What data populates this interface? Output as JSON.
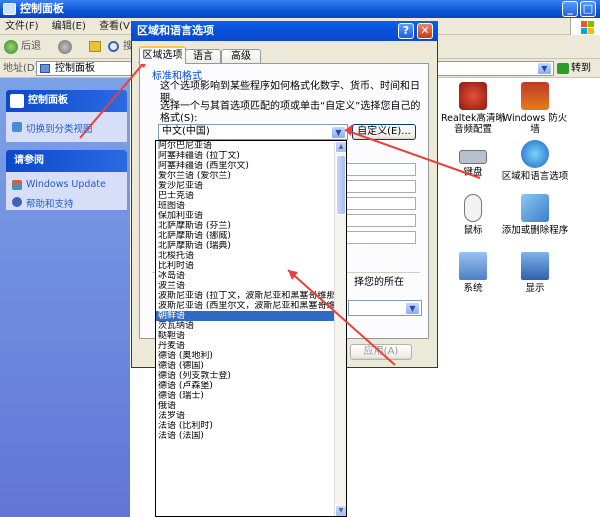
{
  "window": {
    "title": "控制面板"
  },
  "menu": [
    "文件(F)",
    "编辑(E)",
    "查看(V)"
  ],
  "toolbar": {
    "back": "后退",
    "search": "搜"
  },
  "address": {
    "label": "地址(D)",
    "value": "控制面板",
    "go": "转到"
  },
  "sidebar": {
    "panel_title": "控制面板",
    "switch_link": "切换到分类视图",
    "see_also_title": "请参阅",
    "see_also": [
      "Windows Update",
      "帮助和支持"
    ]
  },
  "icons": [
    {
      "label": "Realtek高清晰音频配置"
    },
    {
      "label": "Windows 防火墙"
    },
    {
      "label": "键盘"
    },
    {
      "label": "区域和语言选项"
    },
    {
      "label": "鼠标"
    },
    {
      "label": "添加或删除程序"
    },
    {
      "label": "系统"
    },
    {
      "label": "显示"
    }
  ],
  "dialog": {
    "title": "区域和语言选项",
    "help_btn": "?",
    "close_btn": "✕",
    "tabs": [
      "区域选项",
      "语言",
      "高级"
    ],
    "group_title": "标准和格式",
    "desc": "这个选项影响到某些程序如何格式化数字、货币、时间和日期。",
    "prompt": "选择一个与其首选项匹配的项或单击“自定义”选择您自己的格式(S):",
    "combo_value": "中文(中国)",
    "customize_btn": "自定义(E)...",
    "location_text": "择您的所在",
    "apply_btn": "应用(A)"
  },
  "dropdown": {
    "items": [
      "阿尔巴尼亚语",
      "阿塞拜疆语 (拉丁文)",
      "阿塞拜疆语 (西里尔文)",
      "爱尔兰语 (爱尔兰)",
      "爱沙尼亚语",
      "巴士克语",
      "班图语",
      "保加利亚语",
      "北萨摩斯语 (芬兰)",
      "北萨摩斯语 (挪威)",
      "北萨摩斯语 (瑞典)",
      "北梭托语",
      "比利时语",
      "冰岛语",
      "波兰语",
      "波斯尼亚语 (拉丁文，波斯尼亚和黑塞哥维那)",
      "波斯尼亚语 (西里尔文，波斯尼亚和黑塞哥维那)",
      "朝鲜语",
      "茨瓦纳语",
      "鞑靼语",
      "丹麦语",
      "德语 (奥地利)",
      "德语 (德国)",
      "德语 (列支敦士登)",
      "德语 (卢森堡)",
      "德语 (瑞士)",
      "俄语",
      "法罗语",
      "法语 (比利时)",
      "法语 (法国)"
    ],
    "selected_index": 17
  },
  "colors": {
    "title_blue": "#0a5fe9",
    "selection": "#316ac5",
    "annotation_red": "#e8403a"
  }
}
